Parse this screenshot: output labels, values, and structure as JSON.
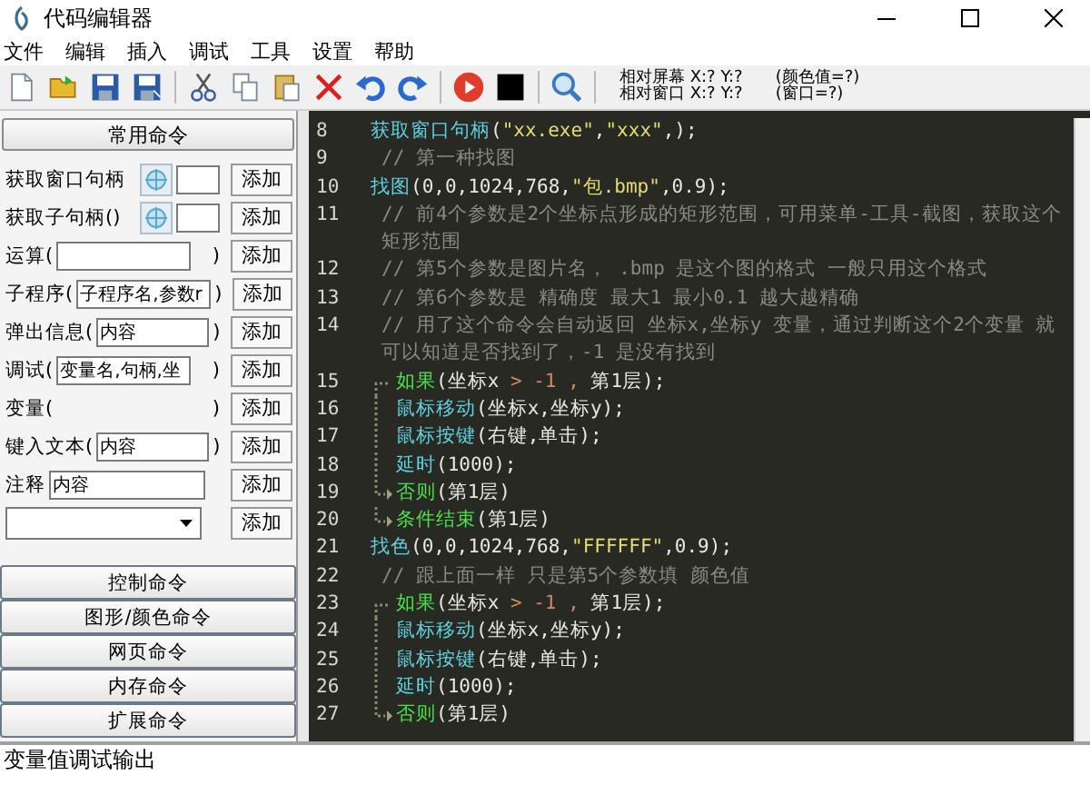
{
  "window": {
    "title": "代码编辑器"
  },
  "menu": [
    "文件",
    "编辑",
    "插入",
    "调试",
    "工具",
    "设置",
    "帮助"
  ],
  "coords": {
    "screen": "相对屏幕 X:? Y:?",
    "window": "相对窗口 X:? Y:?",
    "color_reading": "(颜色值=?)",
    "handle": "(窗口=?)"
  },
  "command_panel": {
    "header": "常用命令",
    "rows": [
      {
        "kind": "picker",
        "label": "获取窗口句柄",
        "button": "添加"
      },
      {
        "kind": "picker",
        "label": "获取子句柄()",
        "button": "添加"
      },
      {
        "kind": "paren-field",
        "label": "运算(",
        "suffix": ")",
        "button": "添加"
      },
      {
        "kind": "paren-field",
        "label": "子程序(",
        "value": "子程序名,参数r",
        "suffix": ")",
        "button": "添加"
      },
      {
        "kind": "paren-field",
        "label": "弹出信息(",
        "value": "内容",
        "suffix": ")",
        "button": "添加"
      },
      {
        "kind": "paren-field",
        "label": "调试(",
        "value": "变量名,句柄,坐",
        "suffix": ")",
        "button": "添加"
      },
      {
        "kind": "paren-empty",
        "label": "变量(",
        "suffix": ")",
        "button": "添加"
      },
      {
        "kind": "paren-field",
        "label": "键入文本(",
        "value": "内容",
        "suffix": ")",
        "button": "添加"
      },
      {
        "kind": "field",
        "label": "注释",
        "value": "内容",
        "button": "添加"
      },
      {
        "kind": "select",
        "button": "添加"
      }
    ],
    "categories": [
      "控制命令",
      "图形/颜色命令",
      "网页命令",
      "内存命令",
      "扩展命令"
    ]
  },
  "code_lines": [
    {
      "number": "8",
      "kind": "plain",
      "segments": [
        {
          "kind": "func",
          "text": "获取窗口句柄"
        },
        {
          "kind": "plain",
          "text": "("
        },
        {
          "kind": "string",
          "text": "\"xx.exe\""
        },
        {
          "kind": "plain",
          "text": ","
        },
        {
          "kind": "string",
          "text": "\"xxx\""
        },
        {
          "kind": "plain",
          "text": ",);"
        }
      ]
    },
    {
      "number": "9",
      "kind": "plain",
      "segments": [
        {
          "kind": "comment",
          "text": "// 第一种找图"
        }
      ]
    },
    {
      "number": "10",
      "kind": "plain",
      "segments": [
        {
          "kind": "func",
          "text": "找图"
        },
        {
          "kind": "plain",
          "text": "(0,0,1024,768,"
        },
        {
          "kind": "string",
          "text": "\"包.bmp\""
        },
        {
          "kind": "plain",
          "text": ",0.9);"
        }
      ]
    },
    {
      "number": "11",
      "kind": "plain",
      "segments": [
        {
          "kind": "comment",
          "text": "// 前4个参数是2个坐标点形成的矩形范围，可用菜单-工具-截图，获取这个矩形范围"
        }
      ]
    },
    {
      "number": "12",
      "kind": "plain",
      "segments": [
        {
          "kind": "comment",
          "text": "// 第5个参数是图片名， .bmp 是这个图的格式 一般只用这个格式"
        }
      ]
    },
    {
      "number": "13",
      "kind": "plain",
      "segments": [
        {
          "kind": "comment",
          "text": "// 第6个参数是 精确度 最大1 最小0.1 越大越精确"
        }
      ]
    },
    {
      "number": "14",
      "kind": "plain",
      "segments": [
        {
          "kind": "comment",
          "text": "// 用了这个命令会自动返回 坐标x,坐标y 变量，通过判断这个2个变量 就可以知道是否找到了，-1 是没有找到"
        }
      ]
    },
    {
      "number": "15",
      "kind": "start",
      "segments": [
        {
          "kind": "keyword",
          "text": "如果"
        },
        {
          "kind": "plain",
          "text": "(坐标x "
        },
        {
          "kind": "operator",
          "text": "> -1 ,"
        },
        {
          "kind": "plain",
          "text": " 第1层);"
        }
      ]
    },
    {
      "number": "16",
      "kind": "body",
      "segments": [
        {
          "kind": "func",
          "text": "鼠标移动"
        },
        {
          "kind": "plain",
          "text": "(坐标x,坐标y);"
        }
      ]
    },
    {
      "number": "17",
      "kind": "body",
      "segments": [
        {
          "kind": "func",
          "text": "鼠标按键"
        },
        {
          "kind": "plain",
          "text": "(右键,单击);"
        }
      ]
    },
    {
      "number": "18",
      "kind": "body",
      "segments": [
        {
          "kind": "func",
          "text": "延时"
        },
        {
          "kind": "plain",
          "text": "(1000);"
        }
      ]
    },
    {
      "number": "19",
      "kind": "arrow",
      "segments": [
        {
          "kind": "keyword",
          "text": "否则"
        },
        {
          "kind": "plain",
          "text": "(第1层)"
        }
      ]
    },
    {
      "number": "20",
      "kind": "arrow",
      "segments": [
        {
          "kind": "keyword",
          "text": "条件结束"
        },
        {
          "kind": "plain",
          "text": "(第1层)"
        }
      ]
    },
    {
      "number": "21",
      "kind": "plain",
      "segments": [
        {
          "kind": "func",
          "text": "找色"
        },
        {
          "kind": "plain",
          "text": "(0,0,1024,768,"
        },
        {
          "kind": "string",
          "text": "\"FFFFFF\""
        },
        {
          "kind": "plain",
          "text": ",0.9);"
        }
      ]
    },
    {
      "number": "22",
      "kind": "plain",
      "segments": [
        {
          "kind": "comment",
          "text": "// 跟上面一样 只是第5个参数填 颜色值"
        }
      ]
    },
    {
      "number": "23",
      "kind": "start",
      "segments": [
        {
          "kind": "keyword",
          "text": "如果"
        },
        {
          "kind": "plain",
          "text": "(坐标x "
        },
        {
          "kind": "operator",
          "text": "> -1 ,"
        },
        {
          "kind": "plain",
          "text": " 第1层);"
        }
      ]
    },
    {
      "number": "24",
      "kind": "body",
      "segments": [
        {
          "kind": "func",
          "text": "鼠标移动"
        },
        {
          "kind": "plain",
          "text": "(坐标x,坐标y);"
        }
      ]
    },
    {
      "number": "25",
      "kind": "body",
      "segments": [
        {
          "kind": "func",
          "text": "鼠标按键"
        },
        {
          "kind": "plain",
          "text": "(右键,单击);"
        }
      ]
    },
    {
      "number": "26",
      "kind": "body",
      "segments": [
        {
          "kind": "func",
          "text": "延时"
        },
        {
          "kind": "plain",
          "text": "(1000);"
        }
      ]
    },
    {
      "number": "27",
      "kind": "arrow",
      "segments": [
        {
          "kind": "keyword",
          "text": "否则"
        },
        {
          "kind": "plain",
          "text": "(第1层)"
        }
      ]
    }
  ],
  "output": {
    "title": "变量值调试输出"
  }
}
